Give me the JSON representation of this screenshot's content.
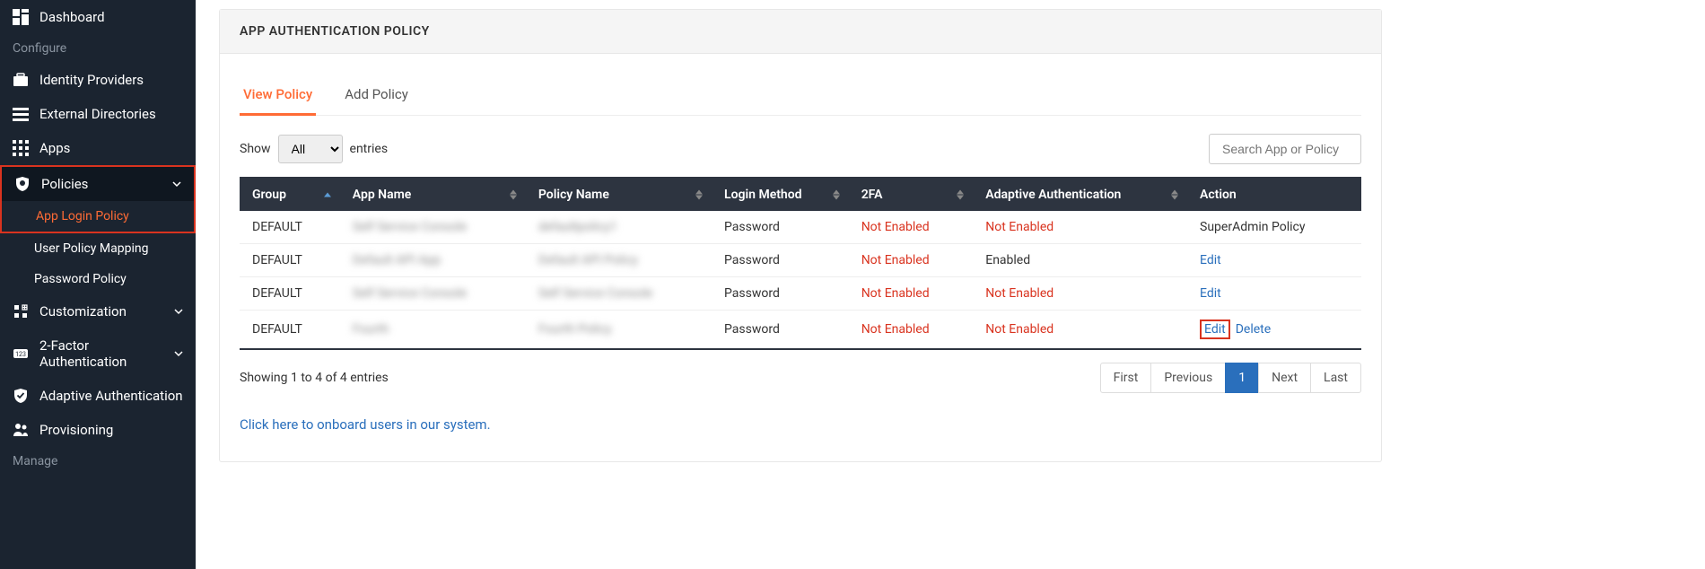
{
  "sidebar": {
    "dashboard": "Dashboard",
    "configure": "Configure",
    "identity_providers": "Identity Providers",
    "external_directories": "External Directories",
    "apps": "Apps",
    "policies": "Policies",
    "app_login_policy": "App Login Policy",
    "user_policy_mapping": "User Policy Mapping",
    "password_policy": "Password Policy",
    "customization": "Customization",
    "two_factor": "2-Factor Authentication",
    "adaptive_auth": "Adaptive Authentication",
    "provisioning": "Provisioning",
    "manage": "Manage"
  },
  "header": {
    "title": "APP AUTHENTICATION POLICY"
  },
  "tabs": {
    "view": "View Policy",
    "add": "Add Policy"
  },
  "entries": {
    "show": "Show",
    "all": "All",
    "entries_label": "entries",
    "search_placeholder": "Search App or Policy"
  },
  "columns": {
    "group": "Group",
    "app_name": "App Name",
    "policy_name": "Policy Name",
    "login_method": "Login Method",
    "twofa": "2FA",
    "adaptive": "Adaptive Authentication",
    "action": "Action"
  },
  "rows": [
    {
      "group": "DEFAULT",
      "app": "Self Service Console",
      "policy": "defaultpolicy1",
      "login": "Password",
      "twofa": "Not Enabled",
      "adaptive": "Not Enabled",
      "action_type": "superadmin",
      "action_label": "SuperAdmin Policy"
    },
    {
      "group": "DEFAULT",
      "app": "Default API App",
      "policy": "Default API Policy",
      "login": "Password",
      "twofa": "Not Enabled",
      "adaptive": "Enabled",
      "action_type": "edit",
      "edit": "Edit"
    },
    {
      "group": "DEFAULT",
      "app": "Self Service Console",
      "policy": "Self Service Console",
      "login": "Password",
      "twofa": "Not Enabled",
      "adaptive": "Not Enabled",
      "action_type": "edit",
      "edit": "Edit"
    },
    {
      "group": "DEFAULT",
      "app": "Fourth",
      "policy": "Fourth Policy",
      "login": "Password",
      "twofa": "Not Enabled",
      "adaptive": "Not Enabled",
      "action_type": "edit_delete_highlight",
      "edit": "Edit",
      "delete": "Delete"
    }
  ],
  "footer": {
    "showing": "Showing 1 to 4 of 4 entries",
    "first": "First",
    "previous": "Previous",
    "page1": "1",
    "next": "Next",
    "last": "Last"
  },
  "onboard": "Click here to onboard users in our system.",
  "colors": {
    "accent": "#ff6b35",
    "link": "#2a6fbc",
    "danger": "#d9331f",
    "sidebar_bg": "#1b2430",
    "table_header": "#2d3440"
  }
}
